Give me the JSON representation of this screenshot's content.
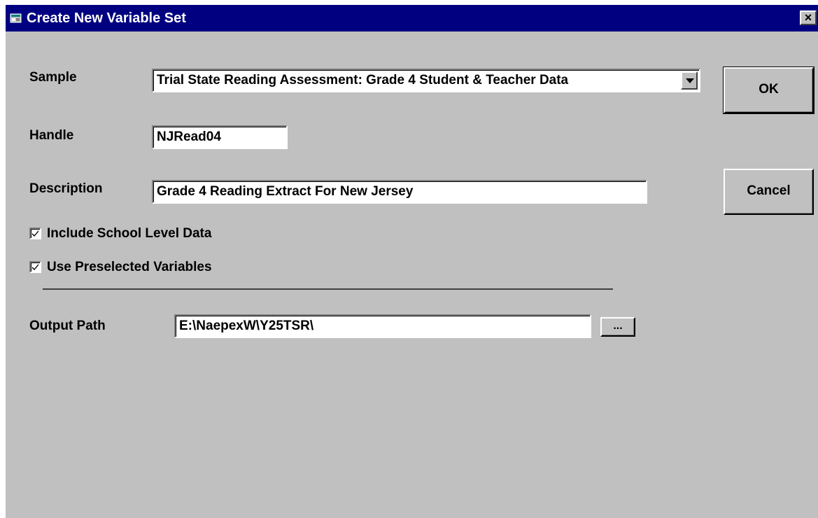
{
  "window": {
    "title": "Create New Variable Set",
    "close_label": "×"
  },
  "form": {
    "sample_label": "Sample",
    "sample_value": "Trial State Reading Assessment: Grade 4 Student & Teacher Data",
    "handle_label": "Handle",
    "handle_value": "NJRead04",
    "description_label": "Description",
    "description_value": "Grade 4 Reading Extract For New Jersey",
    "include_school_label": "Include School Level Data",
    "include_school_checked": true,
    "use_preselected_label": "Use Preselected Variables",
    "use_preselected_checked": true,
    "output_path_label": "Output Path",
    "output_path_value": "E:\\NaepexW\\Y25TSR\\",
    "browse_label": "..."
  },
  "buttons": {
    "ok_label": "OK",
    "cancel_label": "Cancel"
  },
  "icons": {
    "title_icon": "window-app-icon",
    "dropdown_icon": "chevron-down-icon",
    "check_icon": "checkmark-icon"
  },
  "colors": {
    "titlebar": "#000080",
    "face": "#c0c0c0"
  }
}
